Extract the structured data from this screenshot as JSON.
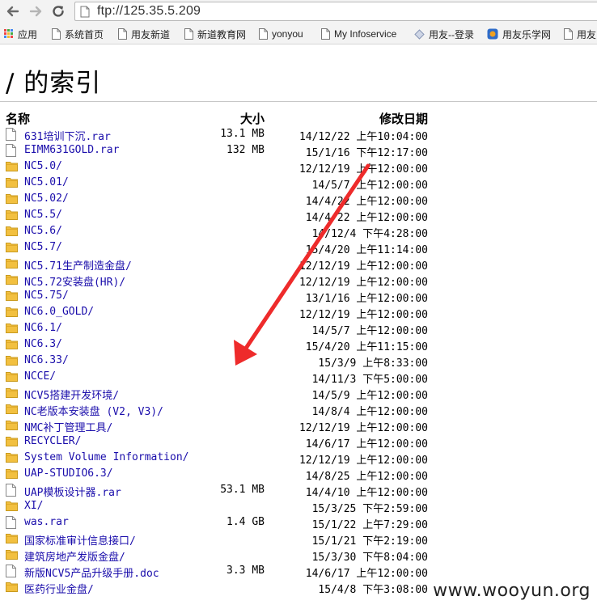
{
  "browser": {
    "url": "ftp://125.35.5.209",
    "bookmarks": [
      {
        "label": "应用",
        "icon": "apps-grid-icon"
      },
      {
        "label": "系统首页",
        "icon": "page-icon"
      },
      {
        "label": "用友新道",
        "icon": "page-icon"
      },
      {
        "label": "新道教育网",
        "icon": "page-icon"
      },
      {
        "label": "yonyou",
        "icon": "page-icon"
      },
      {
        "label": "My Infoservice",
        "icon": "page-icon"
      },
      {
        "label": "用友--登录",
        "icon": "puzzle-icon"
      },
      {
        "label": "用友乐学网",
        "icon": "site-icon"
      },
      {
        "label": "用友",
        "icon": "page-icon"
      }
    ]
  },
  "page": {
    "title": "/ 的索引",
    "columns": {
      "name": "名称",
      "size": "大小",
      "modified": "修改日期"
    },
    "entries": [
      {
        "name": "631培训下沉.rar",
        "size": "13.1 MB",
        "date": "14/12/22 上午10:04:00",
        "type": "file"
      },
      {
        "name": "EIMM631GOLD.rar",
        "size": "132 MB",
        "date": "15/1/16 下午12:17:00",
        "type": "file"
      },
      {
        "name": "NC5.0/",
        "size": "",
        "date": "12/12/19 上午12:00:00",
        "type": "folder"
      },
      {
        "name": "NC5.01/",
        "size": "",
        "date": "14/5/7 上午12:00:00",
        "type": "folder"
      },
      {
        "name": "NC5.02/",
        "size": "",
        "date": "14/4/22 上午12:00:00",
        "type": "folder"
      },
      {
        "name": "NC5.5/",
        "size": "",
        "date": "14/4/22 上午12:00:00",
        "type": "folder"
      },
      {
        "name": "NC5.6/",
        "size": "",
        "date": "14/12/4 下午4:28:00",
        "type": "folder"
      },
      {
        "name": "NC5.7/",
        "size": "",
        "date": "15/4/20 上午11:14:00",
        "type": "folder"
      },
      {
        "name": "NC5.71生产制造金盘/",
        "size": "",
        "date": "12/12/19 上午12:00:00",
        "type": "folder"
      },
      {
        "name": "NC5.72安装盘(HR)/",
        "size": "",
        "date": "12/12/19 上午12:00:00",
        "type": "folder"
      },
      {
        "name": "NC5.75/",
        "size": "",
        "date": "13/1/16 上午12:00:00",
        "type": "folder"
      },
      {
        "name": "NC6.0_GOLD/",
        "size": "",
        "date": "12/12/19 上午12:00:00",
        "type": "folder"
      },
      {
        "name": "NC6.1/",
        "size": "",
        "date": "14/5/7 上午12:00:00",
        "type": "folder"
      },
      {
        "name": "NC6.3/",
        "size": "",
        "date": "15/4/20 上午11:15:00",
        "type": "folder"
      },
      {
        "name": "NC6.33/",
        "size": "",
        "date": "15/3/9 上午8:33:00",
        "type": "folder"
      },
      {
        "name": "NCCE/",
        "size": "",
        "date": "14/11/3 下午5:00:00",
        "type": "folder"
      },
      {
        "name": "NCV5搭建开发环境/",
        "size": "",
        "date": "14/5/9 上午12:00:00",
        "type": "folder"
      },
      {
        "name": "NC老版本安装盘 (V2, V3)/",
        "size": "",
        "date": "14/8/4 上午12:00:00",
        "type": "folder"
      },
      {
        "name": "NMC补丁管理工具/",
        "size": "",
        "date": "12/12/19 上午12:00:00",
        "type": "folder"
      },
      {
        "name": "RECYCLER/",
        "size": "",
        "date": "14/6/17 上午12:00:00",
        "type": "folder"
      },
      {
        "name": "System Volume Information/",
        "size": "",
        "date": "12/12/19 上午12:00:00",
        "type": "folder"
      },
      {
        "name": "UAP-STUDIO6.3/",
        "size": "",
        "date": "14/8/25 上午12:00:00",
        "type": "folder"
      },
      {
        "name": "UAP模板设计器.rar",
        "size": "53.1 MB",
        "date": "14/4/10 上午12:00:00",
        "type": "file"
      },
      {
        "name": "XI/",
        "size": "",
        "date": "15/3/25 下午2:59:00",
        "type": "folder"
      },
      {
        "name": "was.rar",
        "size": "1.4 GB",
        "date": "15/1/22 上午7:29:00",
        "type": "file"
      },
      {
        "name": "国家标准审计信息接口/",
        "size": "",
        "date": "15/1/21 下午2:19:00",
        "type": "folder"
      },
      {
        "name": "建筑房地产发版金盘/",
        "size": "",
        "date": "15/3/30 下午8:04:00",
        "type": "folder"
      },
      {
        "name": "新版NCV5产品升级手册.doc",
        "size": "3.3 MB",
        "date": "14/6/17 上午12:00:00",
        "type": "file"
      },
      {
        "name": "医药行业金盘/",
        "size": "",
        "date": "15/4/8 下午3:08:00",
        "type": "folder"
      }
    ]
  },
  "watermark": "www.wooyun.org",
  "colors": {
    "link": "#1a0dab",
    "folder": "#f2c040",
    "arrow": "#ee2b2b"
  }
}
